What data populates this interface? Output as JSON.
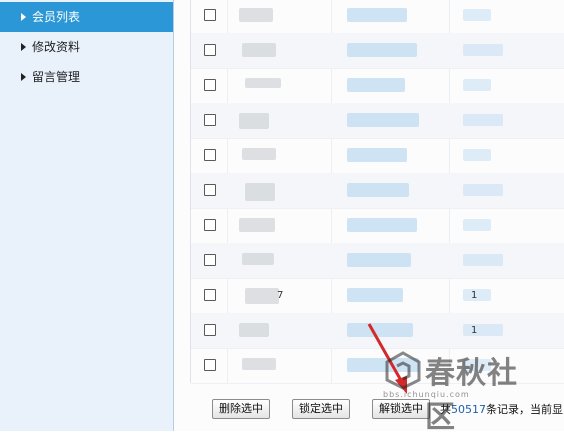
{
  "sidebar": {
    "items": [
      {
        "label": "会员列表",
        "active": true
      },
      {
        "label": "修改资料",
        "active": false
      },
      {
        "label": "留言管理",
        "active": false
      }
    ]
  },
  "table": {
    "rows": [
      {
        "c1": "",
        "c3": ""
      },
      {
        "c1": "",
        "c3": ""
      },
      {
        "c1": "",
        "c3": ""
      },
      {
        "c1": "",
        "c3": ""
      },
      {
        "c1": "",
        "c3": ""
      },
      {
        "c1": "",
        "c3": ""
      },
      {
        "c1": "",
        "c3": ""
      },
      {
        "c1": "",
        "c3": ""
      },
      {
        "c1": "7",
        "c3": "1"
      },
      {
        "c1": "",
        "c3": "1"
      },
      {
        "c1": "",
        "c3": ""
      }
    ]
  },
  "toolbar": {
    "delete_label": "删除选中",
    "lock_label": "锁定选中",
    "unlock_label": "解锁选中",
    "summary_prefix": "共",
    "record_count": "50517",
    "summary_suffix": "条记录，当前显"
  },
  "watermark": {
    "text": "春秋社区",
    "url": "bbs.ichunqiu.com"
  },
  "colors": {
    "sidebar_bg": "#e9f1fb",
    "active_item": "#2b97d6",
    "count_link": "#1f5fae"
  }
}
